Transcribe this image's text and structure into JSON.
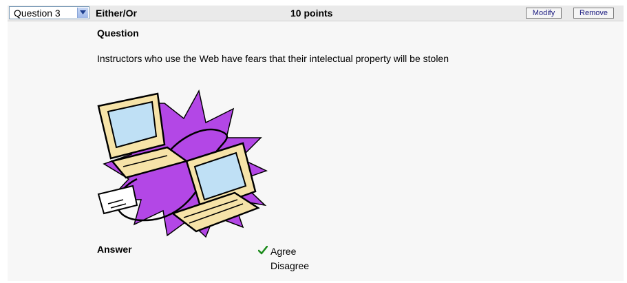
{
  "header": {
    "question_select": "Question 3",
    "question_type": "Either/Or",
    "points": "10 points",
    "modify_label": "Modify",
    "remove_label": "Remove"
  },
  "question": {
    "heading": "Question",
    "text": "Instructors who use the Web have fears that their intelectual property will be stolen",
    "image_icon": "networked-computers-clipart"
  },
  "answer": {
    "heading": "Answer",
    "options": [
      {
        "label": "Agree",
        "correct": true,
        "mark_icon": "check-icon"
      },
      {
        "label": "Disagree",
        "correct": false
      }
    ]
  },
  "colors": {
    "check": "#1a8a1a",
    "burst": "#b347e6",
    "monitor": "#f6e3a8",
    "screen": "#bfe0f5"
  }
}
